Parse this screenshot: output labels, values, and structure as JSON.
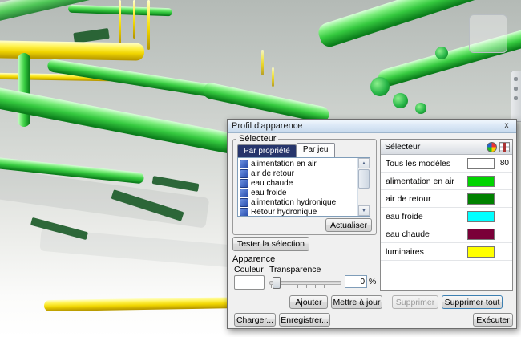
{
  "dialog": {
    "title": "Profil d'apparence",
    "close_label": "x",
    "selector_group": {
      "title": "Sélecteur",
      "tabs": [
        {
          "label": "Par propriété"
        },
        {
          "label": "Par jeu"
        }
      ],
      "sets": [
        "alimentation en air",
        "air de retour",
        "eau chaude",
        "eau froide",
        "alimentation hydronique",
        "Retour hydronique"
      ],
      "refresh_button": "Actualiser",
      "test_button": "Tester la sélection"
    },
    "appearance_group": {
      "title": "Apparence",
      "color_label": "Couleur",
      "transparency_label": "Transparence",
      "transparency_value": "0",
      "percent_label": "%"
    },
    "selector_table": {
      "header": "Sélecteur",
      "rows": [
        {
          "label": "Tous les modèles",
          "color": "#ffffff",
          "value": "80"
        },
        {
          "label": "alimentation en air",
          "color": "#00d400",
          "value": ""
        },
        {
          "label": "air de retour",
          "color": "#008200",
          "value": ""
        },
        {
          "label": "eau froide",
          "color": "#00ffff",
          "value": ""
        },
        {
          "label": "eau chaude",
          "color": "#7a0038",
          "value": ""
        },
        {
          "label": "luminaires",
          "color": "#ffff00",
          "value": ""
        }
      ]
    },
    "buttons": {
      "add": "Ajouter",
      "update": "Mettre à jour",
      "delete": "Supprimer",
      "delete_all": "Supprimer tout",
      "load": "Charger...",
      "save": "Enregistrer...",
      "run": "Exécuter"
    }
  }
}
